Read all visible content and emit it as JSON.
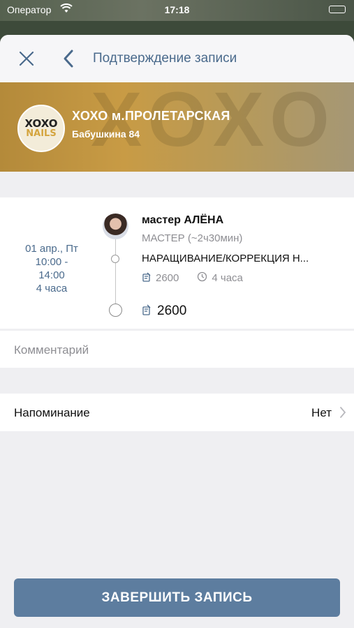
{
  "status_bar": {
    "carrier": "Оператор",
    "time": "17:18",
    "battery_level": 1.0
  },
  "nav": {
    "title": "Подтверждение записи"
  },
  "salon": {
    "logo_line1": "XOXO",
    "logo_line2": "NAILS",
    "name": "ХОХО м.ПРОЛЕТАРСКАЯ",
    "address": "Бабушкина 84"
  },
  "booking": {
    "date": "01 апр., Пт",
    "time_start": "10:00 -",
    "time_end": "14:00",
    "duration": "4 часа",
    "master_name": "мастер АЛЁНА",
    "master_role": "МАСТЕР (~2ч30мин)",
    "service_name": "НАРАЩИВАНИЕ/КОРРЕКЦИЯ Н...",
    "service_price": "2600",
    "service_duration": "4 часа",
    "total": "2600"
  },
  "comment": {
    "placeholder": "Комментарий"
  },
  "reminder": {
    "label": "Напоминание",
    "value": "Нет"
  },
  "actions": {
    "finish_label": "ЗАВЕРШИТЬ ЗАПИСЬ"
  },
  "colors": {
    "accent": "#4a6a8c",
    "button": "#5d7d9f",
    "banner": "#c89b45"
  },
  "icons": [
    "wifi-icon",
    "battery-icon",
    "close-icon",
    "back-chevron-icon",
    "price-tag-icon",
    "clock-icon",
    "chevron-right-icon"
  ]
}
